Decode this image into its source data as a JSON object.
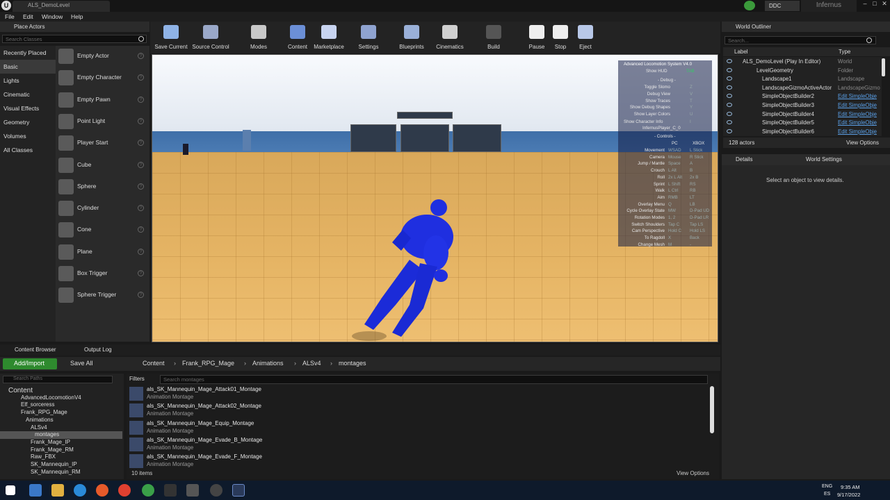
{
  "window": {
    "tab_title": "ALS_DemoLevel",
    "ddc_label": "DDC",
    "project": "Infernus",
    "min": "–",
    "max": "□",
    "close": "✕"
  },
  "menu": [
    "File",
    "Edit",
    "Window",
    "Help"
  ],
  "place_actors": {
    "title": "Place Actors",
    "search_placeholder": "Search Classes",
    "categories": [
      "Recently Placed",
      "Basic",
      "Lights",
      "Cinematic",
      "Visual Effects",
      "Geometry",
      "Volumes",
      "All Classes"
    ],
    "selected_category": "Basic",
    "actors": [
      "Empty Actor",
      "Empty Character",
      "Empty Pawn",
      "Point Light",
      "Player Start",
      "Cube",
      "Sphere",
      "Cylinder",
      "Cone",
      "Plane",
      "Box Trigger",
      "Sphere Trigger"
    ]
  },
  "toolbar": [
    {
      "label": "Save Current",
      "icon": "save-icon",
      "color": "#8fb3e6"
    },
    {
      "label": "Source Control",
      "icon": "source-control-icon",
      "color": "#9aa8c8"
    },
    {
      "label": "Modes",
      "icon": "modes-icon",
      "color": "#c8c8c8"
    },
    {
      "label": "Content",
      "icon": "content-icon",
      "color": "#6b8fd6"
    },
    {
      "label": "Marketplace",
      "icon": "marketplace-icon",
      "color": "#c8d4f0"
    },
    {
      "label": "Settings",
      "icon": "settings-icon",
      "color": "#8fa3d0"
    },
    {
      "label": "Blueprints",
      "icon": "blueprints-icon",
      "color": "#9ab0d8"
    },
    {
      "label": "Cinematics",
      "icon": "cinematics-icon",
      "color": "#d0d0d0"
    },
    {
      "label": "Build",
      "icon": "build-icon",
      "color": "#555555"
    },
    {
      "label": "Pause",
      "icon": "pause-icon",
      "color": "#eeeeee"
    },
    {
      "label": "Stop",
      "icon": "stop-icon",
      "color": "#eeeeee"
    },
    {
      "label": "Eject",
      "icon": "eject-icon",
      "color": "#b8c8e8"
    }
  ],
  "hud": {
    "title": "Advanced Locomotion System V4.0",
    "show_hud": "Show HUD",
    "show_hud_key": "TAB",
    "debug_header": "- Debug -",
    "debug": [
      {
        "label": "Toggle Slomo",
        "key": "Z"
      },
      {
        "label": "Debug View",
        "key": "V"
      },
      {
        "label": "Show Traces",
        "key": "T"
      },
      {
        "label": "Show Debug Shapes",
        "key": "Y"
      },
      {
        "label": "Show Layer Colors",
        "key": "U"
      }
    ],
    "char_info": "Show Character Info",
    "char_info_key": "I",
    "player_name": "InfernusPlayer_C_0",
    "controls_header": "- Controls -",
    "col_pc": "PC",
    "col_xbox": "XBOX",
    "controls": [
      {
        "label": "Movement",
        "pc": "WSAD",
        "xbox": "L Stick"
      },
      {
        "label": "Camera",
        "pc": "Mouse",
        "xbox": "R Stick"
      },
      {
        "label": "Jump / Mantle",
        "pc": "Space",
        "xbox": "A"
      },
      {
        "label": "Crouch",
        "pc": "L Alt",
        "xbox": "B"
      },
      {
        "label": "Roll",
        "pc": "2x L Alt",
        "xbox": "2x B"
      },
      {
        "label": "Sprint",
        "pc": "L Shift",
        "xbox": "RS"
      },
      {
        "label": "Walk",
        "pc": "L Ctrl",
        "xbox": "RB"
      },
      {
        "label": "Aim",
        "pc": "RMB",
        "xbox": "LT"
      },
      {
        "label": "Overlay Menu",
        "pc": "Q",
        "xbox": "LB"
      },
      {
        "label": "Cycle Overlay State",
        "pc": "MW",
        "xbox": "D-Pad UD"
      },
      {
        "label": "Rotation Modes",
        "pc": "1, 2",
        "xbox": "D-Pad LR"
      },
      {
        "label": "Switch Shoulders",
        "pc": "Tap C",
        "xbox": "Tap LS"
      },
      {
        "label": "Cam Perspective",
        "pc": "Hold C",
        "xbox": "Hold LS"
      },
      {
        "label": "To Ragdoll",
        "pc": "X",
        "xbox": "Back"
      },
      {
        "label": "Change Mesh",
        "pc": "M",
        "xbox": "-"
      }
    ]
  },
  "world_outliner": {
    "title": "World Outliner",
    "search_placeholder": "Search...",
    "col_label": "Label",
    "col_type": "Type",
    "rows": [
      {
        "name": "ALS_DemoLevel (Play In Editor)",
        "type": "World",
        "indent": 28,
        "link": false
      },
      {
        "name": "LevelGeometry",
        "type": "Folder",
        "indent": 48,
        "link": false
      },
      {
        "name": "Landscape1",
        "type": "Landscape",
        "indent": 56,
        "link": false
      },
      {
        "name": "LandscapeGizmoActiveActor",
        "type": "LandscapeGizmo",
        "indent": 56,
        "link": false
      },
      {
        "name": "SimpleObjectBuilder2",
        "type": "Edit SimpleObje",
        "indent": 56,
        "link": true
      },
      {
        "name": "SimpleObjectBuilder3",
        "type": "Edit SimpleObje",
        "indent": 56,
        "link": true
      },
      {
        "name": "SimpleObjectBuilder4",
        "type": "Edit SimpleObje",
        "indent": 56,
        "link": true
      },
      {
        "name": "SimpleObjectBuilder5",
        "type": "Edit SimpleObje",
        "indent": 56,
        "link": true
      },
      {
        "name": "SimpleObjectBuilder6",
        "type": "Edit SimpleObje",
        "indent": 56,
        "link": true
      }
    ],
    "count": "128 actors",
    "view_options": "View Options"
  },
  "details": {
    "tab": "Details",
    "world_settings_tab": "World Settings",
    "empty_text": "Select an object to view details."
  },
  "content_browser": {
    "tab": "Content Browser",
    "output_tab": "Output Log",
    "add_import": "Add/Import",
    "save_all": "Save All",
    "breadcrumb": [
      "Content",
      "Frank_RPG_Mage",
      "Animations",
      "ALSv4",
      "montages"
    ],
    "path_search": "Search Paths",
    "filters": "Filters",
    "asset_search": "Search montages",
    "tree": [
      {
        "name": "Content",
        "indent": 12,
        "sel": false
      },
      {
        "name": "AdvancedLocomotionV4",
        "indent": 30,
        "sel": false
      },
      {
        "name": "Elf_sorceress",
        "indent": 30,
        "sel": false
      },
      {
        "name": "Frank_RPG_Mage",
        "indent": 30,
        "sel": false
      },
      {
        "name": "Animations",
        "indent": 37,
        "sel": false
      },
      {
        "name": "ALSv4",
        "indent": 44,
        "sel": false
      },
      {
        "name": "montages",
        "indent": 50,
        "sel": true
      },
      {
        "name": "Frank_Mage_IP",
        "indent": 44,
        "sel": false
      },
      {
        "name": "Frank_Mage_RM",
        "indent": 44,
        "sel": false
      },
      {
        "name": "Raw_FBX",
        "indent": 44,
        "sel": false
      },
      {
        "name": "SK_Mannequin_IP",
        "indent": 44,
        "sel": false
      },
      {
        "name": "SK_Mannequin_RM",
        "indent": 44,
        "sel": false
      }
    ],
    "assets": [
      {
        "name": "als_SK_Mannequin_Mage_Attack01_Montage",
        "type": "Animation Montage"
      },
      {
        "name": "als_SK_Mannequin_Mage_Attack02_Montage",
        "type": "Animation Montage"
      },
      {
        "name": "als_SK_Mannequin_Mage_Equip_Montage",
        "type": "Animation Montage"
      },
      {
        "name": "als_SK_Mannequin_Mage_Evade_B_Montage",
        "type": "Animation Montage"
      },
      {
        "name": "als_SK_Mannequin_Mage_Evade_F_Montage",
        "type": "Animation Montage"
      }
    ],
    "item_count": "10 items",
    "view_options": "View Options"
  },
  "taskbar": {
    "lang": "ENG",
    "region": "ES",
    "time": "9:35 AM",
    "date": "9/17/2022"
  },
  "colors": {
    "accent_green": "#2e8a2e",
    "link_blue": "#5aa0e8",
    "character_blue": "#1f2fe0"
  }
}
